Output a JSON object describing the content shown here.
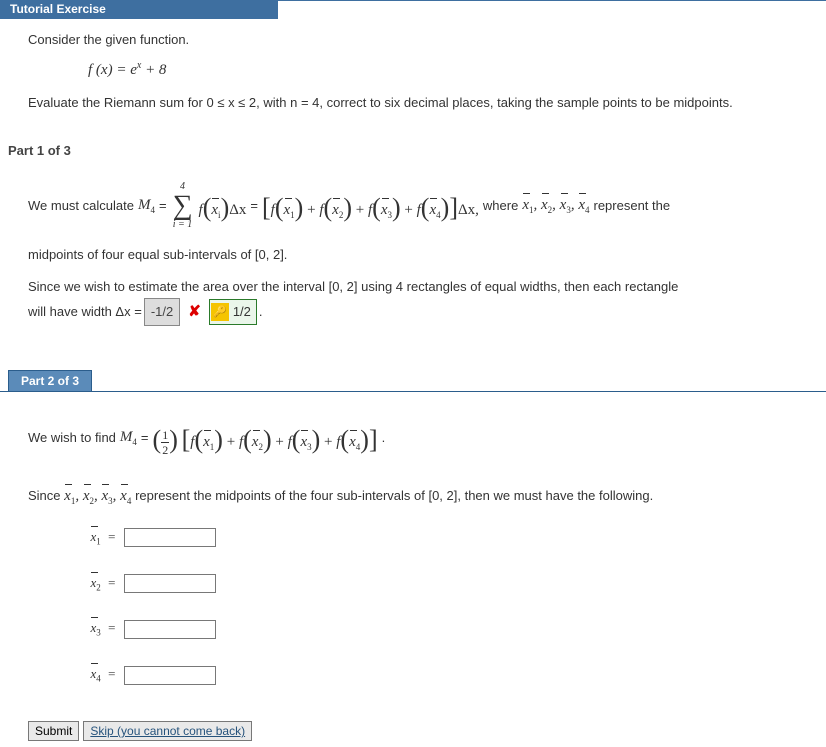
{
  "header": {
    "title": "Tutorial Exercise"
  },
  "problem": {
    "intro": "Consider the given function.",
    "func_lhs": "f (x) = ",
    "func_rhs_base": "e",
    "func_rhs_exp": "x",
    "func_rhs_tail": " + 8",
    "task": "Evaluate the Riemann sum for 0 ≤ x ≤ 2, with n = 4, correct to six decimal places, taking the sample points to be midpoints."
  },
  "part1": {
    "heading": "Part 1 of 3",
    "lead": "We must calculate ",
    "m4_label": "M",
    "m4_sub": "4",
    "eq": " = ",
    "sigma_top": "4",
    "sigma_bot": "i = 1",
    "f": "f",
    "xi": "x",
    "xi_sub": "i",
    "dx": "Δx",
    "plus": " + ",
    "where": "  where  ",
    "tail": "  represent the",
    "line2": "midpoints of four equal sub-intervals of  [0, 2].",
    "para2a": "Since we wish to estimate the area over the interval  [0, 2]  using 4 rectangles of equal widths, then each rectangle",
    "para2b": "will have width  Δx = ",
    "wrong_answer": "-1/2",
    "correct_answer": "1/2",
    "period": "  ."
  },
  "part2": {
    "heading": "Part 2 of 3",
    "lead": "We wish to find  ",
    "m4": "M",
    "m4_sub": "4",
    "eq": " = ",
    "half_num": "1",
    "half_den": "2",
    "period1": ".",
    "para2": "Since  ",
    "para2_tail": "  represent the midpoints of the four sub-intervals of  [0, 2],  then we must have the following.",
    "rows": [
      {
        "label_sub": "1"
      },
      {
        "label_sub": "2"
      },
      {
        "label_sub": "3"
      },
      {
        "label_sub": "4"
      }
    ]
  },
  "buttons": {
    "submit": "Submit",
    "skip": "Skip (you cannot come back)"
  }
}
